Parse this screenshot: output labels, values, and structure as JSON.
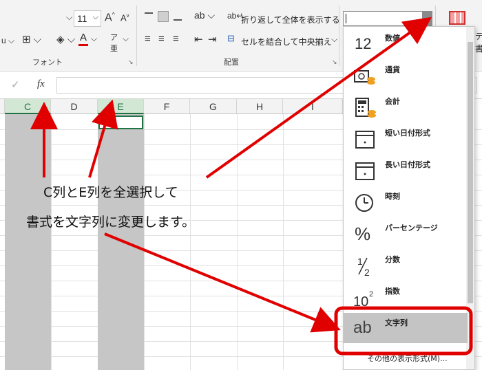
{
  "ribbon": {
    "font_size": "11",
    "font_group_label": "フォント",
    "align_group_label": "配置",
    "wrap_text_label": "折り返して全体を表示する",
    "merge_center_label": "セルを結合して中央揃え",
    "side_text_1": "テ",
    "side_text_2": "書"
  },
  "formula_bar": {
    "fx_label": "fx"
  },
  "columns": [
    "C",
    "D",
    "E",
    "F",
    "G",
    "H",
    "I"
  ],
  "format_menu": {
    "items": [
      {
        "label": "数値",
        "icon": "number-icon"
      },
      {
        "label": "通貨",
        "icon": "currency-icon"
      },
      {
        "label": "会計",
        "icon": "accounting-icon"
      },
      {
        "label": "短い日付形式",
        "icon": "calendar-icon"
      },
      {
        "label": "長い日付形式",
        "icon": "calendar-icon"
      },
      {
        "label": "時刻",
        "icon": "clock-icon"
      },
      {
        "label": "パーセンテージ",
        "icon": "percent-icon"
      },
      {
        "label": "分数",
        "icon": "fraction-icon"
      },
      {
        "label": "指数",
        "icon": "exponent-icon"
      },
      {
        "label": "文字列",
        "icon": "text-ab-icon"
      }
    ],
    "icon_glyphs": {
      "number": "12",
      "text": "ab",
      "percent": "%"
    },
    "more_formats": "その他の表示形式(M)..."
  },
  "annotation": {
    "line1": "C列とE列を全選択して",
    "line2": "書式を文字列に変更します。"
  },
  "colors": {
    "accent": "#217346",
    "annotation_red": "#e00000",
    "selection_gray": "#c6c6c6"
  }
}
